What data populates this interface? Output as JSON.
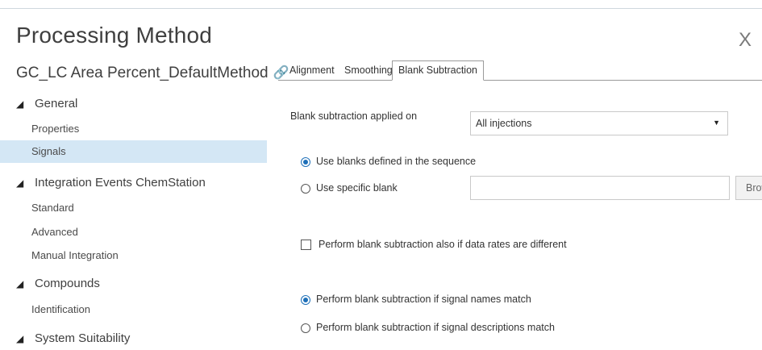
{
  "dialog": {
    "title": "Processing Method",
    "close_glyph": "X"
  },
  "tree": {
    "method_name": "GC_LC Area Percent_DefaultMethod",
    "link_icon": "link-icon",
    "groups": [
      {
        "label": "General",
        "children": [
          "Properties",
          "Signals"
        ]
      },
      {
        "label": "Integration Events ChemStation",
        "children": [
          "Standard",
          "Advanced",
          "Manual Integration"
        ]
      },
      {
        "label": "Compounds",
        "children": [
          "Identification"
        ]
      },
      {
        "label": "System Suitability",
        "children": []
      }
    ],
    "selected": "Signals"
  },
  "tabs": [
    {
      "label": "Alignment"
    },
    {
      "label": "Smoothing"
    },
    {
      "label": "Blank Subtraction",
      "active": true
    }
  ],
  "form": {
    "applied_on_label": "Blank subtraction applied on",
    "applied_on_value": "All injections",
    "radio_sequence_label": "Use blanks defined in the sequence",
    "radio_specific_label": "Use specific blank",
    "specific_blank_value": "",
    "browse_label": "Browse...",
    "checkbox_label": "Perform blank subtraction also if data rates are different",
    "checkbox_checked": false,
    "radio_names_label": "Perform blank subtraction if signal names match",
    "radio_descriptions_label": "Perform blank subtraction if signal descriptions match"
  },
  "colors": {
    "selected_row": "#d4e7f5",
    "radio_accent": "#1d6fb8"
  }
}
